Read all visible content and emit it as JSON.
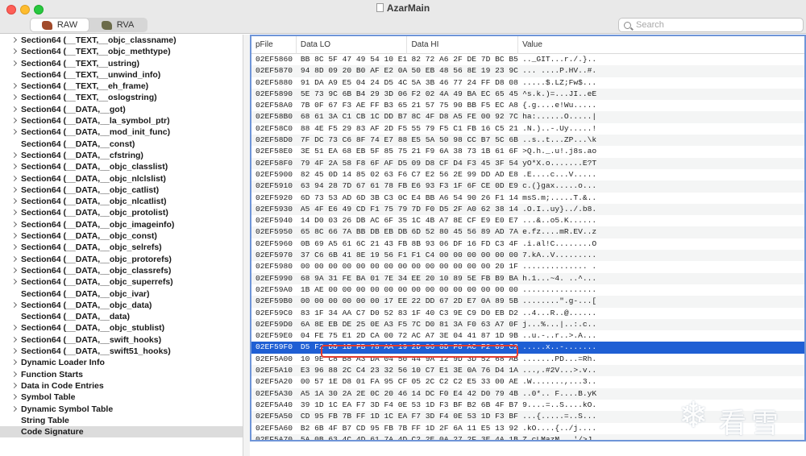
{
  "window": {
    "title": "AzarMain"
  },
  "toolbar": {
    "segments": [
      {
        "label": "RAW",
        "icon": "raw-icon",
        "active": true
      },
      {
        "label": "RVA",
        "icon": "rva-icon",
        "active": false
      }
    ],
    "search_placeholder": "Search"
  },
  "sidebar": {
    "items": [
      {
        "label": "Section64 (__TEXT,__objc_classname)",
        "expandable": true
      },
      {
        "label": "Section64 (__TEXT,__objc_methtype)",
        "expandable": true
      },
      {
        "label": "Section64 (__TEXT,__ustring)",
        "expandable": true
      },
      {
        "label": "Section64 (__TEXT,__unwind_info)",
        "expandable": false
      },
      {
        "label": "Section64 (__TEXT,__eh_frame)",
        "expandable": true
      },
      {
        "label": "Section64 (__TEXT,__oslogstring)",
        "expandable": true
      },
      {
        "label": "Section64 (__DATA,__got)",
        "expandable": true
      },
      {
        "label": "Section64 (__DATA,__la_symbol_ptr)",
        "expandable": true
      },
      {
        "label": "Section64 (__DATA,__mod_init_func)",
        "expandable": true
      },
      {
        "label": "Section64 (__DATA,__const)",
        "expandable": false
      },
      {
        "label": "Section64 (__DATA,__cfstring)",
        "expandable": true
      },
      {
        "label": "Section64 (__DATA,__objc_classlist)",
        "expandable": true
      },
      {
        "label": "Section64 (__DATA,__objc_nlclslist)",
        "expandable": true
      },
      {
        "label": "Section64 (__DATA,__objc_catlist)",
        "expandable": true
      },
      {
        "label": "Section64 (__DATA,__objc_nlcatlist)",
        "expandable": true
      },
      {
        "label": "Section64 (__DATA,__objc_protolist)",
        "expandable": true
      },
      {
        "label": "Section64 (__DATA,__objc_imageinfo)",
        "expandable": true
      },
      {
        "label": "Section64 (__DATA,__objc_const)",
        "expandable": true
      },
      {
        "label": "Section64 (__DATA,__objc_selrefs)",
        "expandable": true
      },
      {
        "label": "Section64 (__DATA,__objc_protorefs)",
        "expandable": true
      },
      {
        "label": "Section64 (__DATA,__objc_classrefs)",
        "expandable": true
      },
      {
        "label": "Section64 (__DATA,__objc_superrefs)",
        "expandable": true
      },
      {
        "label": "Section64 (__DATA,__objc_ivar)",
        "expandable": false
      },
      {
        "label": "Section64 (__DATA,__objc_data)",
        "expandable": true
      },
      {
        "label": "Section64 (__DATA,__data)",
        "expandable": false
      },
      {
        "label": "Section64 (__DATA,__objc_stublist)",
        "expandable": true
      },
      {
        "label": "Section64 (__DATA,__swift_hooks)",
        "expandable": true
      },
      {
        "label": "Section64 (__DATA,__swift51_hooks)",
        "expandable": true
      },
      {
        "label": "Dynamic Loader Info",
        "expandable": true
      },
      {
        "label": "Function Starts",
        "expandable": true
      },
      {
        "label": "Data in Code Entries",
        "expandable": true
      },
      {
        "label": "Symbol Table",
        "expandable": true
      },
      {
        "label": "Dynamic Symbol Table",
        "expandable": true
      },
      {
        "label": "String Table",
        "expandable": false
      },
      {
        "label": "Code Signature",
        "expandable": false,
        "selected": true
      }
    ]
  },
  "table": {
    "headers": {
      "pfile": "pFile",
      "lo": "Data LO",
      "hi": "Data HI",
      "value": "Value"
    },
    "rows": [
      {
        "pfile": "02EF5860",
        "lo": "BB 8C 5F 47 49 54 10 E1",
        "hi": "82 72 A6 2F DE 7D BC B5",
        "value": ".._GIT...r./.}.."
      },
      {
        "pfile": "02EF5870",
        "lo": "94 8D 09 20 B0 AF E2 0A",
        "hi": "50 EB 48 56 8E 19 23 9C",
        "value": "... ....P.HV..#."
      },
      {
        "pfile": "02EF5880",
        "lo": "91 DA A9 E5 04 24 D5 4C",
        "hi": "5A 3B 46 77 24 FF D8 08",
        "value": ".....$.LZ;Fw$..."
      },
      {
        "pfile": "02EF5890",
        "lo": "5E 73 9C 6B B4 29 3D 06",
        "hi": "F2 02 4A 49 BA EC 65 45",
        "value": "^s.k.)=...JI..eE"
      },
      {
        "pfile": "02EF58A0",
        "lo": "7B 0F 67 F3 AE FF B3 65",
        "hi": "21 57 75 90 BB F5 EC A8",
        "value": "{.g....e!Wu....."
      },
      {
        "pfile": "02EF58B0",
        "lo": "68 61 3A C1 CB 1C DD B7",
        "hi": "8C 4F D8 A5 FE 00 92 7C",
        "value": "ha:......O.....|"
      },
      {
        "pfile": "02EF58C0",
        "lo": "88 4E F5 29 83 AF 2D F5",
        "hi": "55 79 F5 C1 FB 16 C5 21",
        "value": ".N.)..-.Uy.....!"
      },
      {
        "pfile": "02EF58D0",
        "lo": "7F DC 73 C6 8F 74 E7 88",
        "hi": "E5 5A 50 98 CC B7 5C 6B",
        "value": "..s..t...ZP...\\k"
      },
      {
        "pfile": "02EF58E0",
        "lo": "3E 51 EA 68 EB 5F 85 75",
        "hi": "21 F9 6A 38 73 1B 61 6F",
        "value": ">Q.h._.u!.j8s.ao"
      },
      {
        "pfile": "02EF58F0",
        "lo": "79 4F 2A 58 F8 6F AF D5",
        "hi": "09 D8 CF D4 F3 45 3F 54",
        "value": "yO*X.o.......E?T"
      },
      {
        "pfile": "02EF5900",
        "lo": "82 45 0D 14 85 02 63 F6",
        "hi": "C7 E2 56 2E 99 DD AD E8",
        "value": ".E....c...V....."
      },
      {
        "pfile": "02EF5910",
        "lo": "63 94 28 7D 67 61 78 FB",
        "hi": "E6 93 F3 1F 6F CE 0D E9",
        "value": "c.(}gax.....o..."
      },
      {
        "pfile": "02EF5920",
        "lo": "6D 73 53 AD 6D 3B C3 0C",
        "hi": "E4 BB A6 54 90 26 F1 14",
        "value": "msS.m;.....T.&.."
      },
      {
        "pfile": "02EF5930",
        "lo": "A5 4F E6 49 CD F1 75 79",
        "hi": "7D F0 D5 2F A0 62 38 14",
        "value": ".O.I..uy}../.b8."
      },
      {
        "pfile": "02EF5940",
        "lo": "14 D0 03 26 DB AC 6F 35",
        "hi": "1C 4B A7 8E CF E9 E0 E7",
        "value": "...&..o5.K......"
      },
      {
        "pfile": "02EF5950",
        "lo": "65 8C 66 7A BB DB EB DB",
        "hi": "6D 52 80 45 56 89 AD 7A",
        "value": "e.fz....mR.EV..z"
      },
      {
        "pfile": "02EF5960",
        "lo": "0B 69 A5 61 6C 21 43 FB",
        "hi": "8B 93 06 DF 16 FD C3 4F",
        "value": ".i.al!C........O"
      },
      {
        "pfile": "02EF5970",
        "lo": "37 C6 6B 41 8E 19 56 F1",
        "hi": "F1 C4 00 00 00 00 00 00",
        "value": "7.kA..V........."
      },
      {
        "pfile": "02EF5980",
        "lo": "00 00 00 00 00 00 00 00",
        "hi": "00 00 00 00 00 00 20 1F",
        "value": ".............. ."
      },
      {
        "pfile": "02EF5990",
        "lo": "68 9A 31 FE BA 01 7E 34",
        "hi": "EE 20 10 89 5E FB B9 BA",
        "value": "h.1...~4. ..^..."
      },
      {
        "pfile": "02EF59A0",
        "lo": "1B AE 00 00 00 00 00 00",
        "hi": "00 00 00 00 00 00 00 00",
        "value": "................"
      },
      {
        "pfile": "02EF59B0",
        "lo": "00 00 00 00 00 00 17 EE",
        "hi": "22 DD 67 2D E7 0A 89 5B",
        "value": "........\".g-...["
      },
      {
        "pfile": "02EF59C0",
        "lo": "83 1F 34 AA C7 D0 52 83",
        "hi": "1F 40 C3 9E C9 D0 EB D2",
        "value": "..4...R..@......"
      },
      {
        "pfile": "02EF59D0",
        "lo": "6A 8E EB DE 25 0E A3 F5",
        "hi": "7C D0 81 3A F0 63 A7 0F",
        "value": "j...%...|..:.c.."
      },
      {
        "pfile": "02EF59E0",
        "lo": "04 FE 75 E1 2D CA 00 72",
        "hi": "AC A7 3E 04 41 87 1D 9B",
        "value": "..u.-..r..>.A..."
      },
      {
        "pfile": "02EF59F0",
        "lo": "D5 F2 DD 1B FB 78 AA 19",
        "hi": "2D 06 8D F8 AC F2 09 C2",
        "value": ".....x..-.......",
        "selected": true
      },
      {
        "pfile": "02EF5A00",
        "lo": "10 9E C8 B8 A3 DA 04 50",
        "hi": "44 9A 12 9D 3D 52 68 AB",
        "value": ".......PD...=Rh."
      },
      {
        "pfile": "02EF5A10",
        "lo": "E3 96 88 2C C4 23 32 56",
        "hi": "10 C7 E1 3E 0A 76 D4 1A",
        "value": "...,.#2V...>.v.."
      },
      {
        "pfile": "02EF5A20",
        "lo": "00 57 1E D8 01 FA 95 CF",
        "hi": "05 2C C2 C2 E5 33 00 AE",
        "value": ".W.......,...3.."
      },
      {
        "pfile": "02EF5A30",
        "lo": "A5 1A 30 2A 2E 0C 20 46",
        "hi": "14 DC F0 E4 42 D0 79 4B",
        "value": "..0*.. F....B.yK"
      },
      {
        "pfile": "02EF5A40",
        "lo": "39 1D 1C EA F7 3D F4 0E",
        "hi": "53 1D F3 BF B2 6B 4F B7",
        "value": "9....=..S....kO."
      },
      {
        "pfile": "02EF5A50",
        "lo": "CD 95 FB 7B FF 1D 1C EA",
        "hi": "F7 3D F4 0E 53 1D F3 BF",
        "value": "...{.....=..S..."
      },
      {
        "pfile": "02EF5A60",
        "lo": "B2 6B 4F B7 CD 95 FB 7B",
        "hi": "FF 1D 2F 6A 11 E5 13 92",
        "value": ".kO....{../j...."
      },
      {
        "pfile": "02EF5A70",
        "lo": "5A 0B 63 4C 4D 61 7A 4D",
        "hi": "C2 2E 0A 27 2F 3E 4A 1B",
        "value": "Z.cLMazM...'/>J."
      }
    ]
  },
  "watermark": {
    "text": "看雪",
    "icon": "snowflake-icon"
  },
  "colors": {
    "selection": "#1f5fd4",
    "highlight_box": "#e43a2c",
    "table_border": "#6f95d8"
  }
}
